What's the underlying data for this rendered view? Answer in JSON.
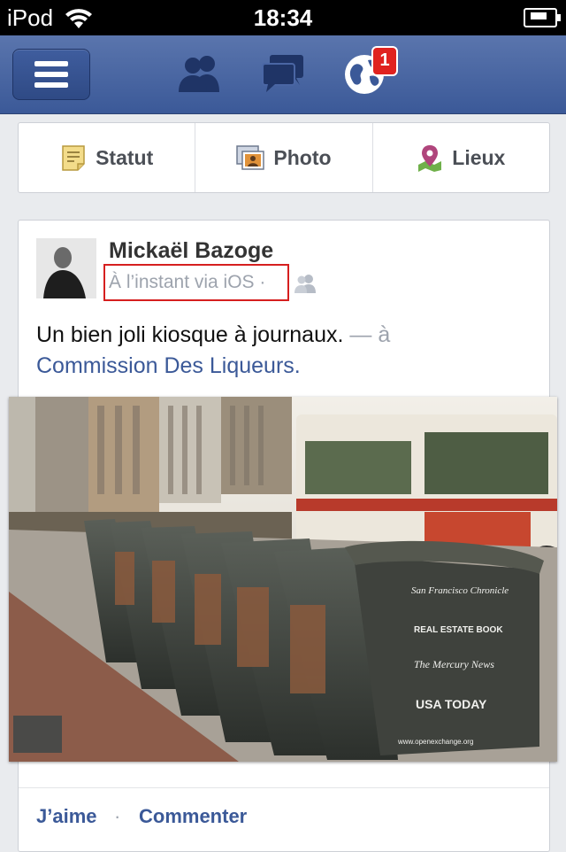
{
  "status": {
    "carrier": "iPod",
    "time": "18:34"
  },
  "navbar": {
    "menu_label": "menu",
    "icons": [
      "friend-requests-icon",
      "messages-icon",
      "notifications-globe-icon"
    ],
    "notification_count": "1"
  },
  "composer": {
    "status_label": "Statut",
    "photo_label": "Photo",
    "places_label": "Lieux"
  },
  "post": {
    "author": "Mickaël Bazoge",
    "meta": "À l’instant via iOS ·",
    "text": "Un bien joli kiosque à journaux.",
    "separator": " — à",
    "place": "Commission Des Liqueurs.",
    "photo_signs": [
      "San Francisco Chronicle",
      "REAL ESTATE BOOK",
      "The Mercury News",
      "USA TODAY",
      "www.openexchange.org"
    ],
    "actions": {
      "like": "J’aime",
      "dot": "·",
      "comment": "Commenter"
    }
  },
  "colors": {
    "brand": "#3b5998",
    "badge": "#e0221f",
    "highlight": "#d61f1f"
  }
}
